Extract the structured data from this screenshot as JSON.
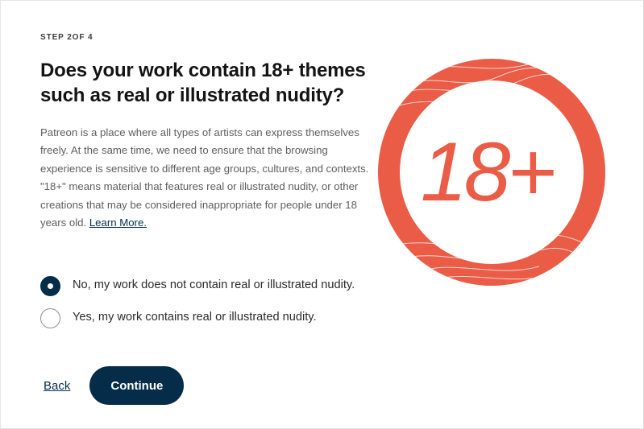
{
  "step": {
    "label": "STEP 2OF 4"
  },
  "question": {
    "title": "Does your work contain 18+ themes such as real or illustrated nudity?"
  },
  "description": {
    "text": "Patreon is a place where all types of artists can express themselves freely. At the same time, we need to ensure that the browsing experience is sensitive to different age groups, cultures, and contexts. \"18+\" means material that features real or illustrated nudity, or other creations that may be considered inappropriate for people under 18 years old. ",
    "link_label": "Learn More."
  },
  "options": [
    {
      "label": "No, my work does not contain real or illustrated nudity.",
      "selected": true
    },
    {
      "label": "Yes, my work contains real or illustrated nudity.",
      "selected": false
    }
  ],
  "actions": {
    "back_label": "Back",
    "continue_label": "Continue"
  },
  "badge": {
    "text": "18+",
    "color": "#eb5c47"
  },
  "colors": {
    "primary": "#052d49",
    "badge": "#eb5c47"
  }
}
